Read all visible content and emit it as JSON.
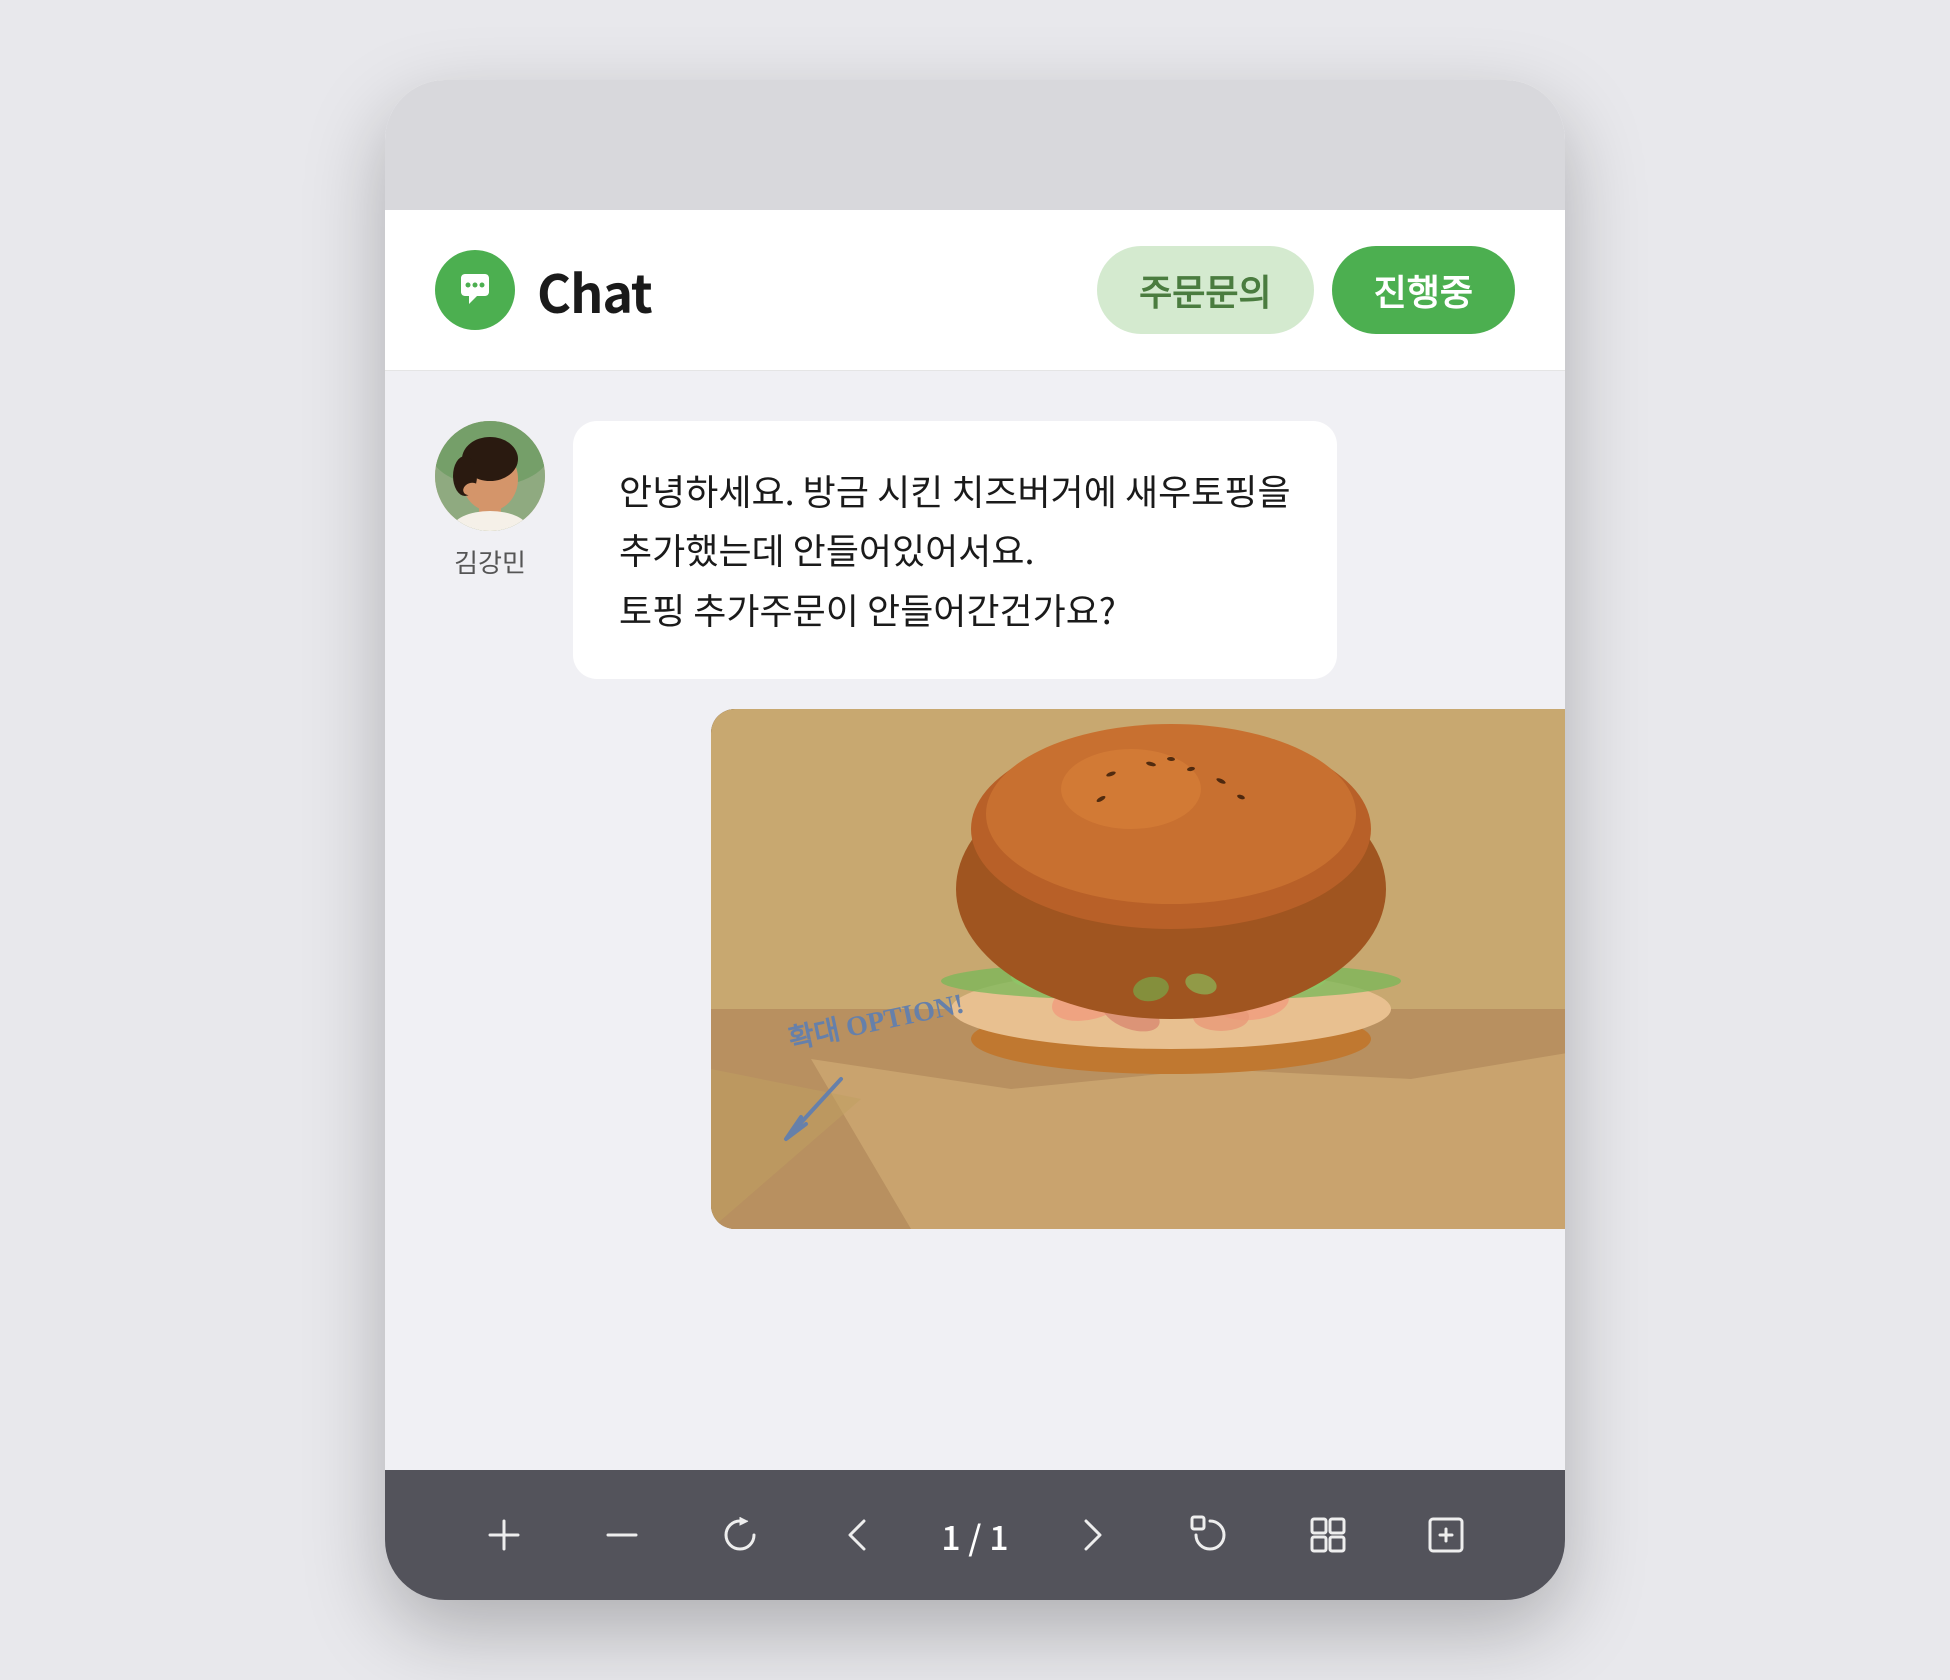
{
  "header": {
    "title": "Chat",
    "btn_order_inquiry": "주문문의",
    "btn_in_progress": "진행중"
  },
  "message": {
    "sender_name": "김강민",
    "text_line1": "안녕하세요. 방금 시킨 치즈버거에 새우토핑을",
    "text_line2": "추가했는데 안들어있어서요.",
    "text_line3": "토핑 추가주문이 안들어간건가요?"
  },
  "image_annotation": {
    "label": "확대 OPTION!",
    "arrow": "↙"
  },
  "toolbar": {
    "plus": "+",
    "minus": "−",
    "refresh": "↻",
    "prev": "＜",
    "page_info": "1 / 1",
    "next": "＞",
    "rotate": "⤾",
    "layout": "⊞",
    "fit": "⊡"
  }
}
